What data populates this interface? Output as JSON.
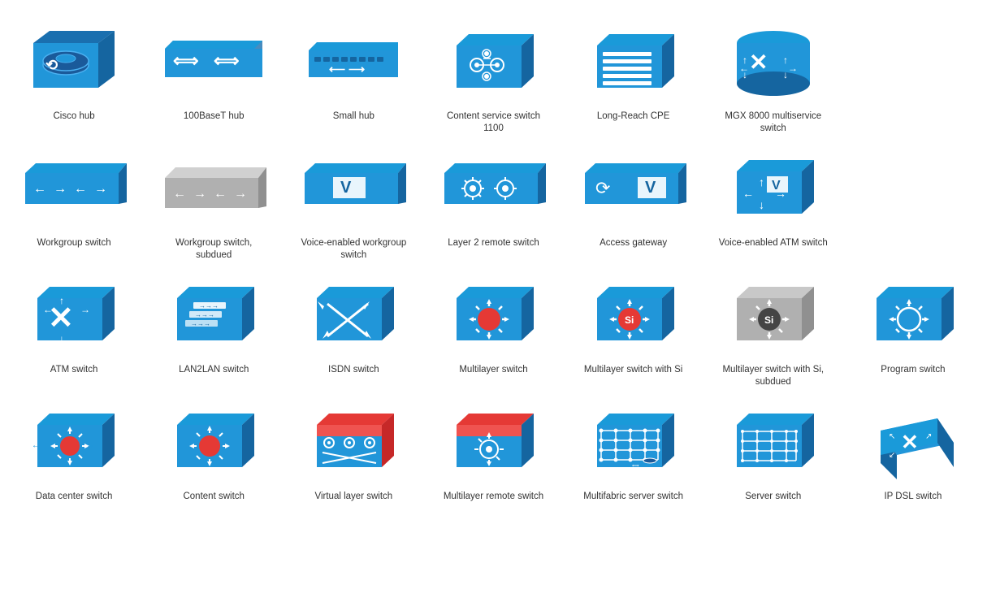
{
  "items": [
    {
      "name": "cisco-hub",
      "label": "Cisco hub"
    },
    {
      "name": "100baset-hub",
      "label": "100BaseT hub"
    },
    {
      "name": "small-hub",
      "label": "Small hub"
    },
    {
      "name": "content-service-switch-1100",
      "label": "Content service switch 1100"
    },
    {
      "name": "long-reach-cpe",
      "label": "Long-Reach CPE"
    },
    {
      "name": "mgx-8000",
      "label": "MGX 8000 multiservice switch"
    },
    {
      "name": "workgroup-switch",
      "label": "Workgroup switch"
    },
    {
      "name": "workgroup-switch-subdued",
      "label": "Workgroup switch, subdued"
    },
    {
      "name": "voice-enabled-workgroup-switch",
      "label": "Voice-enabled workgroup switch"
    },
    {
      "name": "layer2-remote-switch",
      "label": "Layer 2 remote switch"
    },
    {
      "name": "access-gateway",
      "label": "Access gateway"
    },
    {
      "name": "voice-enabled-atm-switch",
      "label": "Voice-enabled ATM switch"
    },
    {
      "name": "atm-switch",
      "label": "ATM switch"
    },
    {
      "name": "lan2lan-switch",
      "label": "LAN2LAN switch"
    },
    {
      "name": "isdn-switch",
      "label": "ISDN switch"
    },
    {
      "name": "multilayer-switch",
      "label": "Multilayer switch"
    },
    {
      "name": "multilayer-switch-si",
      "label": "Multilayer switch with Si"
    },
    {
      "name": "multilayer-switch-si-subdued",
      "label": "Multilayer switch with Si, subdued"
    },
    {
      "name": "program-switch",
      "label": "Program switch"
    },
    {
      "name": "data-center-switch",
      "label": "Data center switch"
    },
    {
      "name": "content-switch",
      "label": "Content switch"
    },
    {
      "name": "virtual-layer-switch",
      "label": "Virtual layer switch"
    },
    {
      "name": "multilayer-remote-switch",
      "label": "Multilayer remote switch"
    },
    {
      "name": "multifabric-server-switch",
      "label": "Multifabric server switch"
    },
    {
      "name": "server-switch",
      "label": "Server switch"
    },
    {
      "name": "ip-dsl-switch",
      "label": "IP DSL switch"
    }
  ]
}
